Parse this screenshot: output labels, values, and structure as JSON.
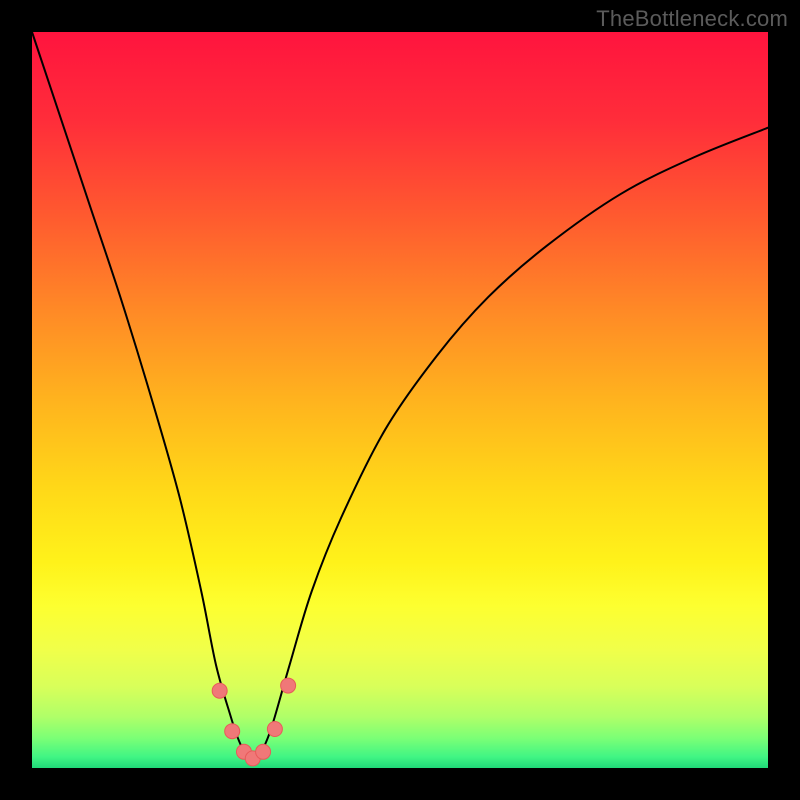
{
  "watermark": {
    "text": "TheBottleneck.com"
  },
  "colors": {
    "watermark_text": "#5b5b5b",
    "black": "#000000",
    "curve": "#000000",
    "marker_fill": "#f07878",
    "marker_stroke": "#e85a5a",
    "gradient_stops": [
      {
        "offset": 0.0,
        "color": "#ff143e"
      },
      {
        "offset": 0.12,
        "color": "#ff2d3a"
      },
      {
        "offset": 0.25,
        "color": "#ff5a2f"
      },
      {
        "offset": 0.38,
        "color": "#ff8a26"
      },
      {
        "offset": 0.5,
        "color": "#ffb31e"
      },
      {
        "offset": 0.62,
        "color": "#ffd818"
      },
      {
        "offset": 0.72,
        "color": "#fff21a"
      },
      {
        "offset": 0.78,
        "color": "#fdff30"
      },
      {
        "offset": 0.84,
        "color": "#f0ff4a"
      },
      {
        "offset": 0.89,
        "color": "#d8ff5a"
      },
      {
        "offset": 0.93,
        "color": "#b0ff68"
      },
      {
        "offset": 0.96,
        "color": "#7aff76"
      },
      {
        "offset": 0.985,
        "color": "#40f584"
      },
      {
        "offset": 1.0,
        "color": "#20d878"
      }
    ]
  },
  "chart_data": {
    "type": "line",
    "title": "",
    "xlabel": "",
    "ylabel": "",
    "xlim": [
      0,
      100
    ],
    "ylim": [
      0,
      100
    ],
    "series": [
      {
        "name": "bottleneck-curve",
        "x": [
          0,
          4,
          8,
          12,
          16,
          20,
          23,
          25,
          27,
          28,
          29,
          30,
          31,
          32,
          33,
          35,
          38,
          42,
          48,
          55,
          62,
          70,
          80,
          90,
          100
        ],
        "y": [
          100,
          88,
          76,
          64,
          51,
          37,
          24,
          14,
          7,
          4,
          2,
          1.5,
          2,
          4,
          7,
          14,
          24,
          34,
          46,
          56,
          64,
          71,
          78,
          83,
          87
        ]
      }
    ],
    "markers": {
      "name": "trough-markers",
      "x": [
        25.5,
        27.2,
        28.8,
        30.0,
        31.4,
        33.0,
        34.8
      ],
      "y": [
        10.5,
        5.0,
        2.2,
        1.3,
        2.2,
        5.3,
        11.2
      ]
    }
  }
}
